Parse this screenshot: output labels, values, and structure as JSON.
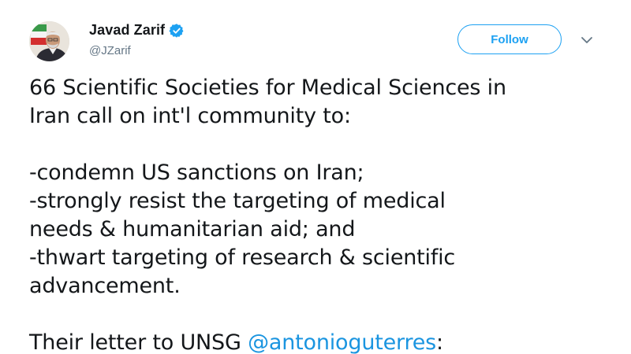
{
  "tweet": {
    "author": {
      "display_name": "Javad Zarif",
      "handle": "@JZarif",
      "verified_icon": "verified-badge-icon",
      "avatar": "avatar"
    },
    "follow_label": "Follow",
    "menu_icon": "chevron-down-icon",
    "body": {
      "line1": "66 Scientific Societies for Medical Sciences in",
      "line2": "Iran call on int'l community to:",
      "line3": "-condemn US sanctions on Iran;",
      "line4": "-strongly resist the targeting of medical",
      "line5": "needs & humanitarian aid; and",
      "line6": "-thwart targeting of research & scientific",
      "line7": "advancement.",
      "line8_prefix": "Their letter to UNSG ",
      "mention": "@antonioguterres",
      "line8_suffix": ":"
    }
  },
  "colors": {
    "accent": "#1da1f2",
    "mention": "#1b95e0",
    "text": "#14171a",
    "secondary": "#657786"
  }
}
